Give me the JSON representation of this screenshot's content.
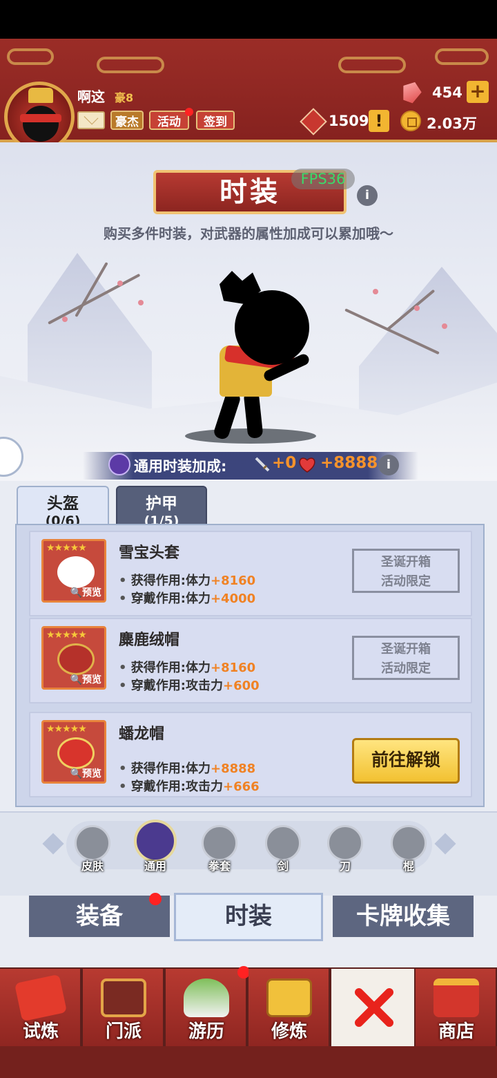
{
  "header": {
    "player_name": "啊这",
    "vip": "豪8",
    "buttons": {
      "hero": "豪杰",
      "event": "活动",
      "checkin": "签到"
    },
    "currency": {
      "gems": "454",
      "honor": "1509",
      "coins": "2.03万"
    }
  },
  "page": {
    "title": "时装",
    "fps": "FPS36",
    "subtitle": "购买多件时装，对武器的属性加成可以累加哦～"
  },
  "bonus": {
    "label": "通用时装加成:",
    "attack": "+0",
    "hp": "+8888"
  },
  "tabs": [
    {
      "name": "头盔",
      "count": "(0/6)"
    },
    {
      "name": "护甲",
      "count": "(1/5)"
    }
  ],
  "items": [
    {
      "name": "雪宝头套",
      "stars": "★★★★★",
      "preview": "🔍预览",
      "obtain_label": "获得作用:体力",
      "obtain_value": "+8160",
      "wear_label": "穿戴作用:体力",
      "wear_value": "+4000",
      "stamp_line1": "圣诞开箱",
      "stamp_line2": "活动限定"
    },
    {
      "name": "麋鹿绒帽",
      "stars": "★★★★★",
      "preview": "🔍预览",
      "obtain_label": "获得作用:体力",
      "obtain_value": "+8160",
      "wear_label": "穿戴作用:攻击力",
      "wear_value": "+600",
      "stamp_line1": "圣诞开箱",
      "stamp_line2": "活动限定"
    },
    {
      "name": "蟠龙帽",
      "stars": "★★★★★",
      "preview": "🔍预览",
      "obtain_label": "获得作用:体力",
      "obtain_value": "+8888",
      "wear_label": "穿戴作用:攻击力",
      "wear_value": "+666",
      "button": "前往解锁"
    }
  ],
  "categories": [
    "皮肤",
    "通用",
    "拳套",
    "剑",
    "刀",
    "棍"
  ],
  "subnav": [
    "装备",
    "时装",
    "卡牌收集"
  ],
  "bottom_nav": [
    "试炼",
    "门派",
    "游历",
    "修炼",
    "商店"
  ],
  "colors": {
    "header_red": "#9b2d27",
    "accent_gold": "#f2b531",
    "value_orange": "#f08224"
  }
}
